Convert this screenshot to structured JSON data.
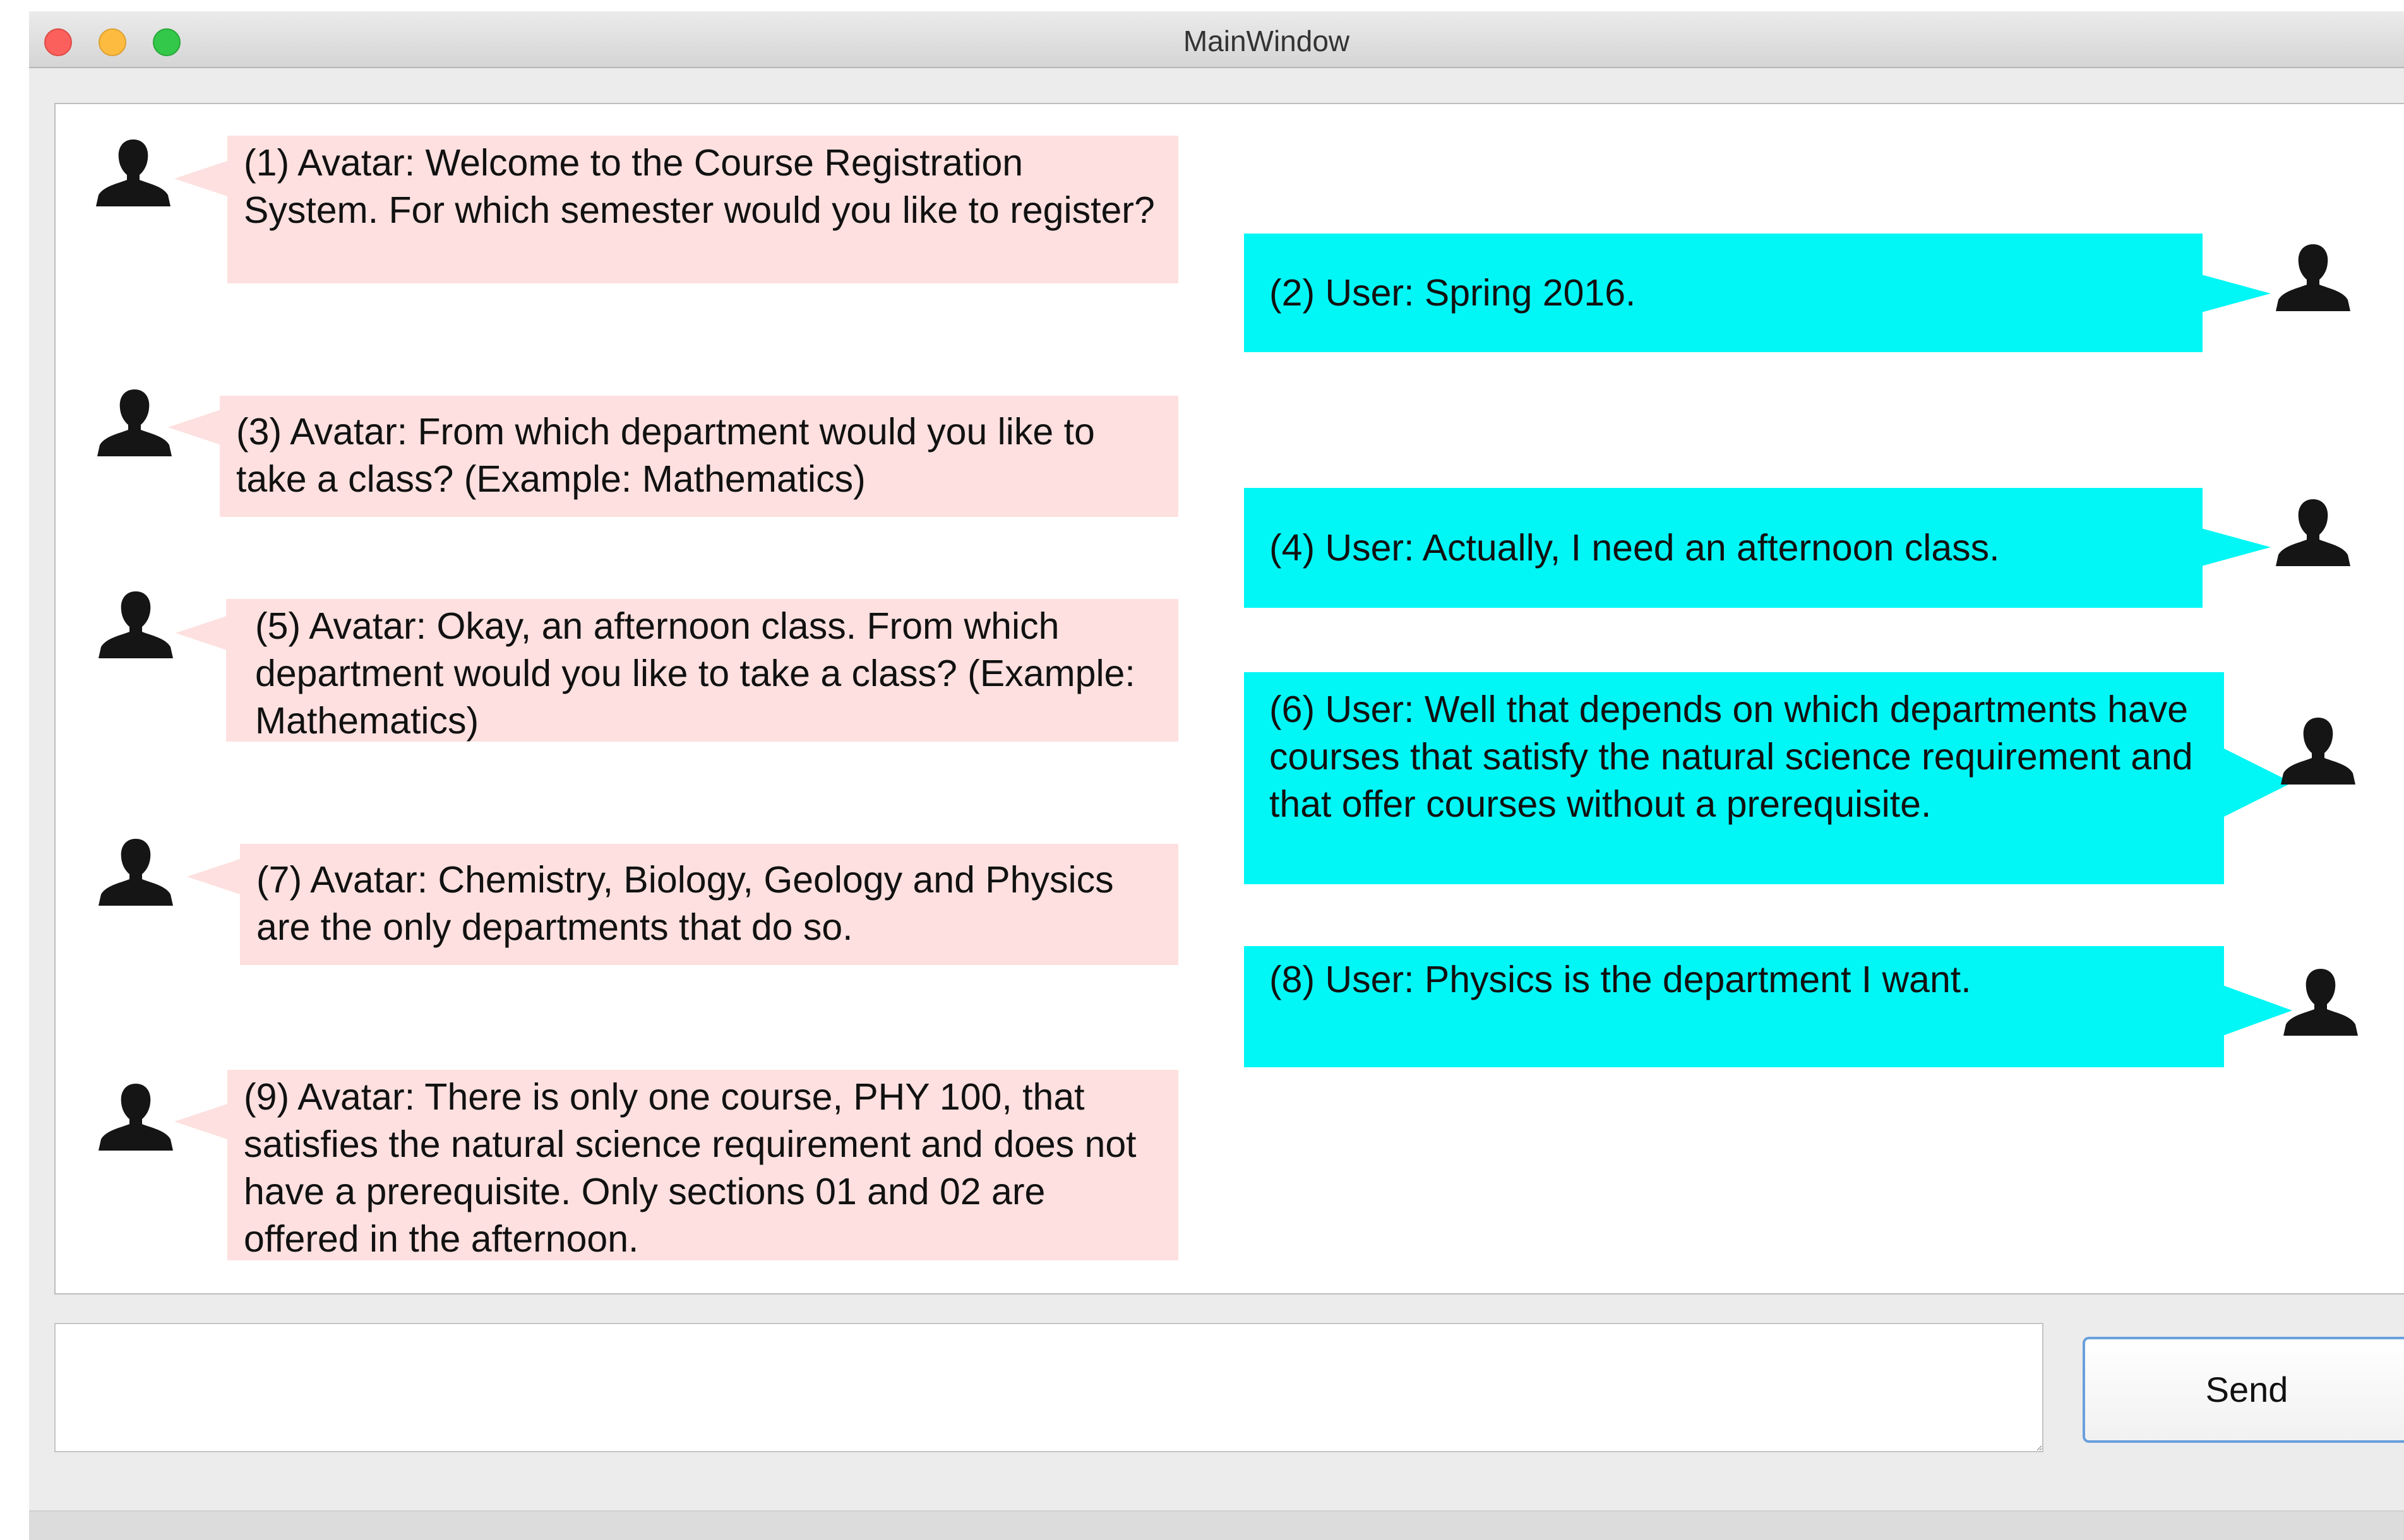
{
  "window": {
    "title": "MainWindow"
  },
  "chat": {
    "messages": [
      {
        "sender": "avatar",
        "text": "(1) Avatar: Welcome to the Course Registration System. For which semester would you like to register?"
      },
      {
        "sender": "user",
        "text": "(2) User: Spring 2016."
      },
      {
        "sender": "avatar",
        "text": "(3) Avatar: From which department would you like to take a class? (Example: Mathematics)"
      },
      {
        "sender": "user",
        "text": "(4) User: Actually, I need an afternoon class."
      },
      {
        "sender": "avatar",
        "text": "(5) Avatar: Okay, an afternoon class. From which department would you like to take a class? (Example: Mathematics)"
      },
      {
        "sender": "user",
        "text": "(6) User: Well that depends on which departments have courses that satisfy the natural science requirement and that offer courses without a prerequisite."
      },
      {
        "sender": "avatar",
        "text": "(7) Avatar: Chemistry, Biology, Geology and Physics are the only departments that do so."
      },
      {
        "sender": "user",
        "text": "(8) User: Physics is the department I want."
      },
      {
        "sender": "avatar",
        "text": "(9) Avatar: There is only one course, PHY 100, that satisfies the natural science requirement and does not have a prerequisite. Only sections 01 and 02 are offered in the afternoon."
      }
    ]
  },
  "composer": {
    "value": "",
    "send_label": "Send"
  },
  "colors": {
    "avatar_bubble": "#fde0df",
    "user_bubble": "#00f7f6"
  },
  "icons": {
    "avatar": "person-silhouette-icon",
    "user": "person-silhouette-icon"
  }
}
